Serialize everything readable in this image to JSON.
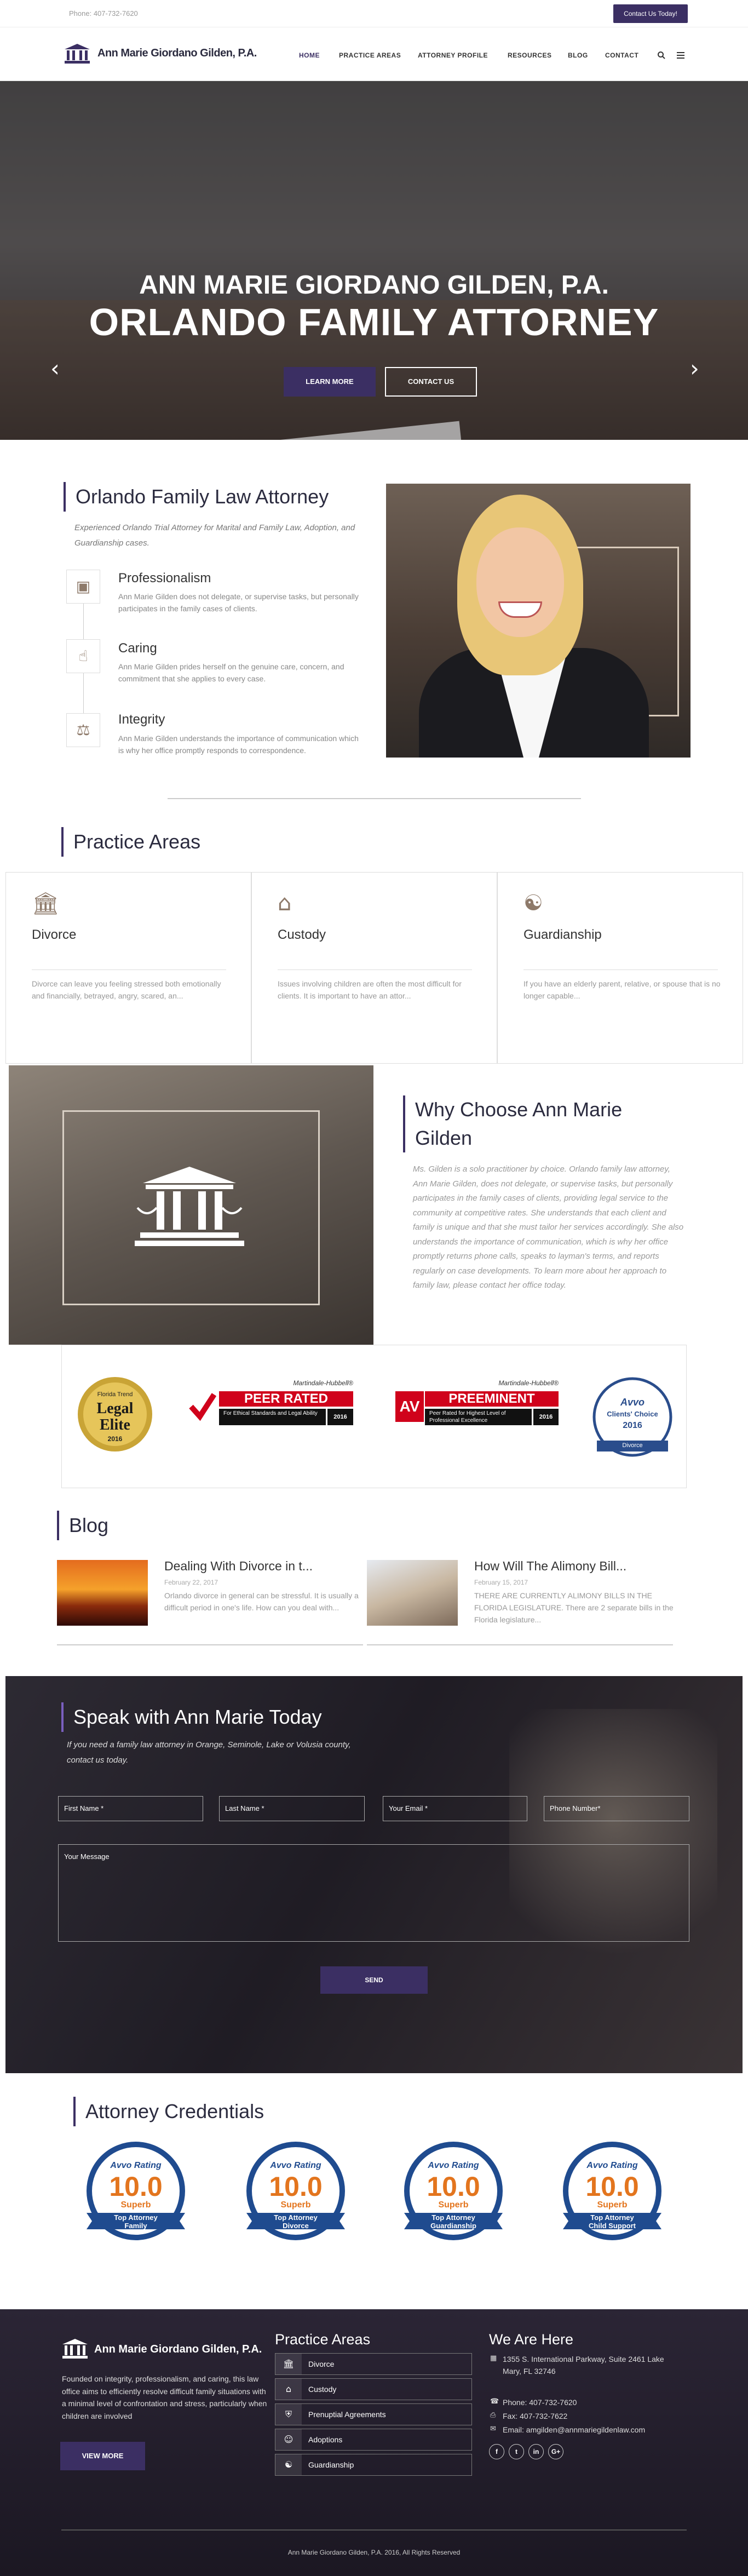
{
  "topbar": {
    "phone": "Phone: 407-732-7620",
    "cta": "Contact Us Today!"
  },
  "header": {
    "logo": "Ann Marie Giordano Gilden, P.A.",
    "nav": [
      "HOME",
      "PRACTICE AREAS",
      "ATTORNEY PROFILE",
      "RESOURCES",
      "BLOG",
      "CONTACT"
    ],
    "search_icon": "search-icon",
    "menu_icon": "hamburger-icon"
  },
  "hero": {
    "line1": "ANN MARIE GIORDANO GILDEN, P.A.",
    "line2": "ORLANDO FAMILY ATTORNEY",
    "btn_learn": "LEARN MORE",
    "btn_contact": "CONTACT US",
    "prev": "‹",
    "next": "›"
  },
  "intro": {
    "title": "Orlando Family Law Attorney",
    "subtitle": "Experienced Orlando Trial Attorney for Marital and Family Law, Adoption, and Guardianship cases.",
    "features": [
      {
        "title": "Professionalism",
        "text": "Ann Marie Gilden does not delegate, or supervise tasks, but personally participates in the family cases of clients.",
        "icon": "briefcase-icon"
      },
      {
        "title": "Caring",
        "text": "Ann Marie Gilden prides herself on the genuine care, concern, and commitment that she applies to every case.",
        "icon": "thumbs-up-icon"
      },
      {
        "title": "Integrity",
        "text": "Ann Marie Gilden understands the importance of communication which is why her office promptly responds to correspondence.",
        "icon": "scales-icon"
      }
    ]
  },
  "practice": {
    "title": "Practice Areas",
    "cards": [
      {
        "name": "Divorce",
        "text": "Divorce can leave you feeling stressed both emotionally and financially, betrayed, angry, scared, an...",
        "icon": "courthouse-icon"
      },
      {
        "name": "Custody",
        "text": "Issues involving children are often the most difficult for clients. It is important to have an attor...",
        "icon": "home-icon"
      },
      {
        "name": "Guardianship",
        "text": "If you have an elderly parent, relative, or spouse that is no longer capable...",
        "icon": "group-icon"
      }
    ]
  },
  "why": {
    "title": "Why Choose Ann Marie Gilden",
    "text": "Ms. Gilden is a solo practitioner by choice. Orlando family law attorney, Ann Marie Gilden, does not delegate, or supervise tasks, but personally participates in the family cases of clients, providing legal service to the community at competitive rates. She understands that each client and family is unique and that she must tailor her services accordingly. She also understands the importance of communication, which is why her office promptly returns phone calls, speaks to layman's terms, and reports regularly on case developments. To learn more about her approach to family law, please contact her office today."
  },
  "badges": {
    "elite": {
      "top": "Florida Trend",
      "mid": "Legal",
      "big": "Elite",
      "year": "2016"
    },
    "peer": {
      "brand": "Martindale-Hubbell®",
      "title": "PEER RATED",
      "sub": "For Ethical Standards and Legal Ability",
      "year": "2016"
    },
    "av": {
      "brand": "Martindale-Hubbell®",
      "title": "PREEMINENT",
      "sub": "Peer Rated for Highest Level of Professional Excellence",
      "year": "2016",
      "mark": "AV"
    },
    "avvo": {
      "brand": "Avvo",
      "title": "Clients' Choice",
      "year": "2016",
      "area": "Divorce"
    }
  },
  "blog": {
    "title": "Blog",
    "posts": [
      {
        "title": "Dealing With Divorce in t...",
        "date": "February 22, 2017",
        "text": "Orlando divorce in general can be stressful.  It is usually a difficult period in one's life. How can you deal with..."
      },
      {
        "title": "How Will The Alimony Bill...",
        "date": "February 15, 2017",
        "text": "THERE ARE CURRENTLY ALIMONY BILLS IN THE FLORIDA LEGISLATURE. There are 2 separate bills in the Florida legislature..."
      }
    ]
  },
  "contact": {
    "title": "Speak with Ann Marie Today",
    "subtitle": "If you need a family law attorney in Orange, Seminole, Lake or Volusia county, contact us today.",
    "first": "First Name *",
    "last": "Last Name *",
    "email": "Your Email *",
    "phone": "Phone Number*",
    "message": "Your Message",
    "send": "SEND"
  },
  "credentials": {
    "title": "Attorney Credentials",
    "items": [
      {
        "brand": "Avvo Rating",
        "score": "10.0",
        "rating": "Superb",
        "label1": "Top Attorney",
        "label2": "Family"
      },
      {
        "brand": "Avvo Rating",
        "score": "10.0",
        "rating": "Superb",
        "label1": "Top Attorney",
        "label2": "Divorce"
      },
      {
        "brand": "Avvo Rating",
        "score": "10.0",
        "rating": "Superb",
        "label1": "Top Attorney",
        "label2": "Guardianship"
      },
      {
        "brand": "Avvo Rating",
        "score": "10.0",
        "rating": "Superb",
        "label1": "Top Attorney",
        "label2": "Child Support"
      }
    ]
  },
  "footer": {
    "logo": "Ann Marie Giordano Gilden, P.A.",
    "about": "Founded on integrity, professionalism, and caring, this law office aims to efficiently resolve difficult family situations with a minimal level of confrontation and stress, particularly when children are involved",
    "view_more": "VIEW MORE",
    "practice_title": "Practice Areas",
    "practice_items": [
      "Divorce",
      "Custody",
      "Prenuptial Agreements",
      "Adoptions",
      "Guardianship"
    ],
    "where_title": "We Are Here",
    "address1": "1355 S. International Parkway, Suite 2461 Lake",
    "address2": "Mary, FL 32746",
    "phone": "Phone: 407-732-7620",
    "fax": "Fax: 407-732-7622",
    "email": "Email: amgilden@annmariegildenlaw.com",
    "social": [
      "f",
      "t",
      "in",
      "G+"
    ],
    "copyright": "Ann Marie Giordano Gilden, P.A. 2016, All Rights Reserved"
  },
  "colors": {
    "brand": "#3b2f63",
    "accent_icon": "#8e7a6a"
  }
}
